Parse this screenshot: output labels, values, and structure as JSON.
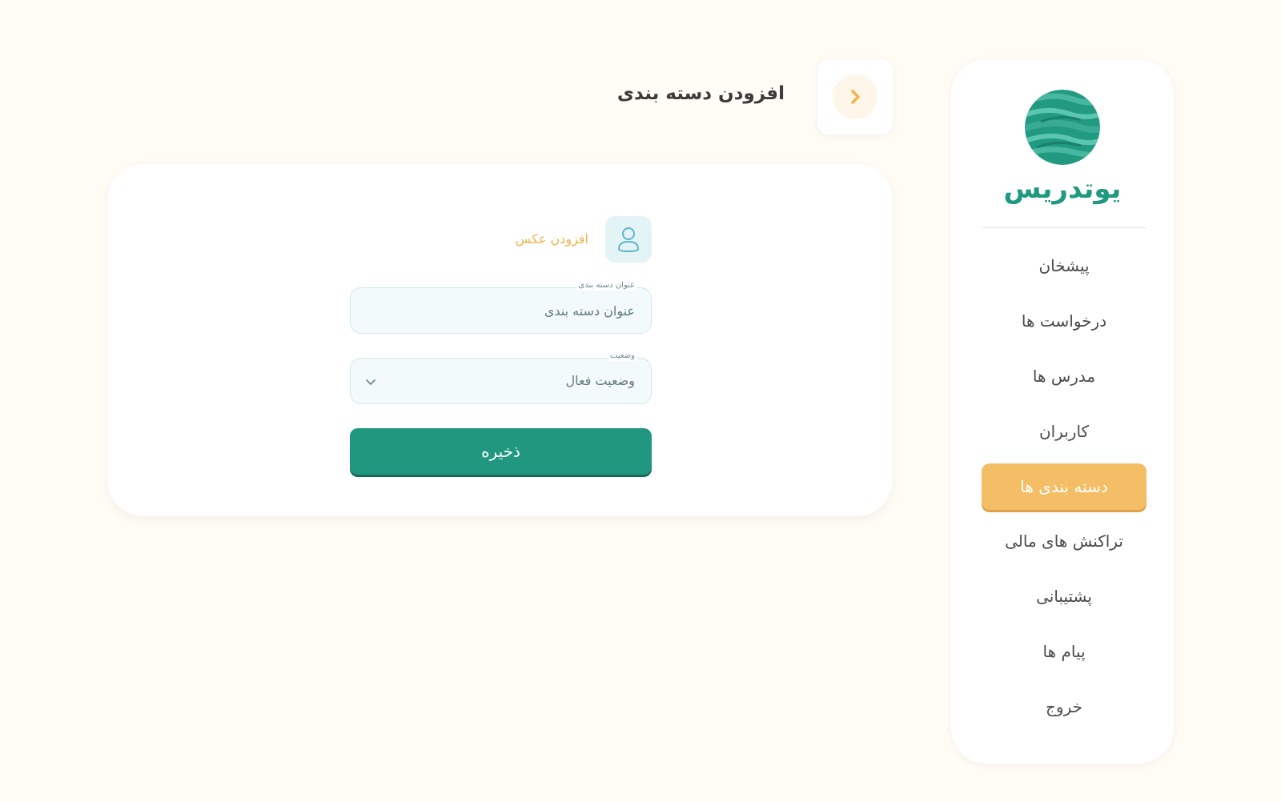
{
  "brand": {
    "name": "یوتدریس"
  },
  "sidebar": {
    "items": [
      {
        "label": "پیشخان",
        "active": false
      },
      {
        "label": "درخواست ها",
        "active": false
      },
      {
        "label": "مدرس ها",
        "active": false
      },
      {
        "label": "کاربران",
        "active": false
      },
      {
        "label": "دسته بندی ها",
        "active": true
      },
      {
        "label": "تراکنش های مالی",
        "active": false
      },
      {
        "label": "پشتیبانی",
        "active": false
      },
      {
        "label": "پیام ها",
        "active": false
      },
      {
        "label": "خروج",
        "active": false
      }
    ]
  },
  "header": {
    "title": "افزودن دسته بندی",
    "back_icon": "chevron-right-icon"
  },
  "form": {
    "add_photo_label": "افزودن عکس",
    "avatar_icon": "user-icon",
    "title_field": {
      "label": "عنوان دسته بندی",
      "placeholder": "عنوان دسته بندی",
      "value": ""
    },
    "status_field": {
      "label": "وضعیت",
      "value": "وضعیت فعال",
      "icon": "chevron-down-icon"
    },
    "save_label": "ذخیره"
  },
  "colors": {
    "accent": "#21977f",
    "active_nav": "#f4be66",
    "background": "#fffbf5"
  }
}
